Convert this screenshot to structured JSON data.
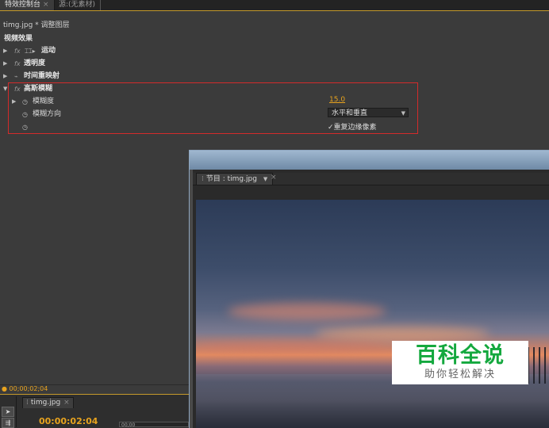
{
  "tabs": {
    "effect_controls": "特效控制台",
    "close_glyph": "×",
    "source": "源:(无素材)"
  },
  "clip_header": "timg.jpg * 调整图层",
  "section_title": "视频效果",
  "effects": [
    {
      "label": "运动",
      "fx": "fx",
      "icon": "motion-icon"
    },
    {
      "label": "透明度",
      "fx": "fx"
    },
    {
      "label": "时间重映射",
      "fx": ""
    },
    {
      "label": "高斯模糊",
      "fx": "fx",
      "expanded": true
    }
  ],
  "gaussian": {
    "blur_label": "模糊度",
    "blur_value": "15.0",
    "direction_label": "模糊方向",
    "direction_value": "水平和垂直",
    "repeat_label": "重复边缘像素",
    "repeat_checked": true
  },
  "monitor": {
    "tab_label": "节目 : timg.jpg",
    "dropdown_glyph": "▼",
    "close_glyph": "×"
  },
  "watermark": {
    "title": "百科全说",
    "subtitle": "助你轻松解决"
  },
  "timeline": {
    "small_timecode": "00;00;02;04",
    "sequence_tab": "timg.jpg",
    "timecode": "00:00:02:04",
    "ruler_label": "00;00"
  },
  "colors": {
    "accent_timecode": "#e8a31e",
    "highlight_box": "#d32a2a",
    "watermark_green": "#14a83e"
  }
}
